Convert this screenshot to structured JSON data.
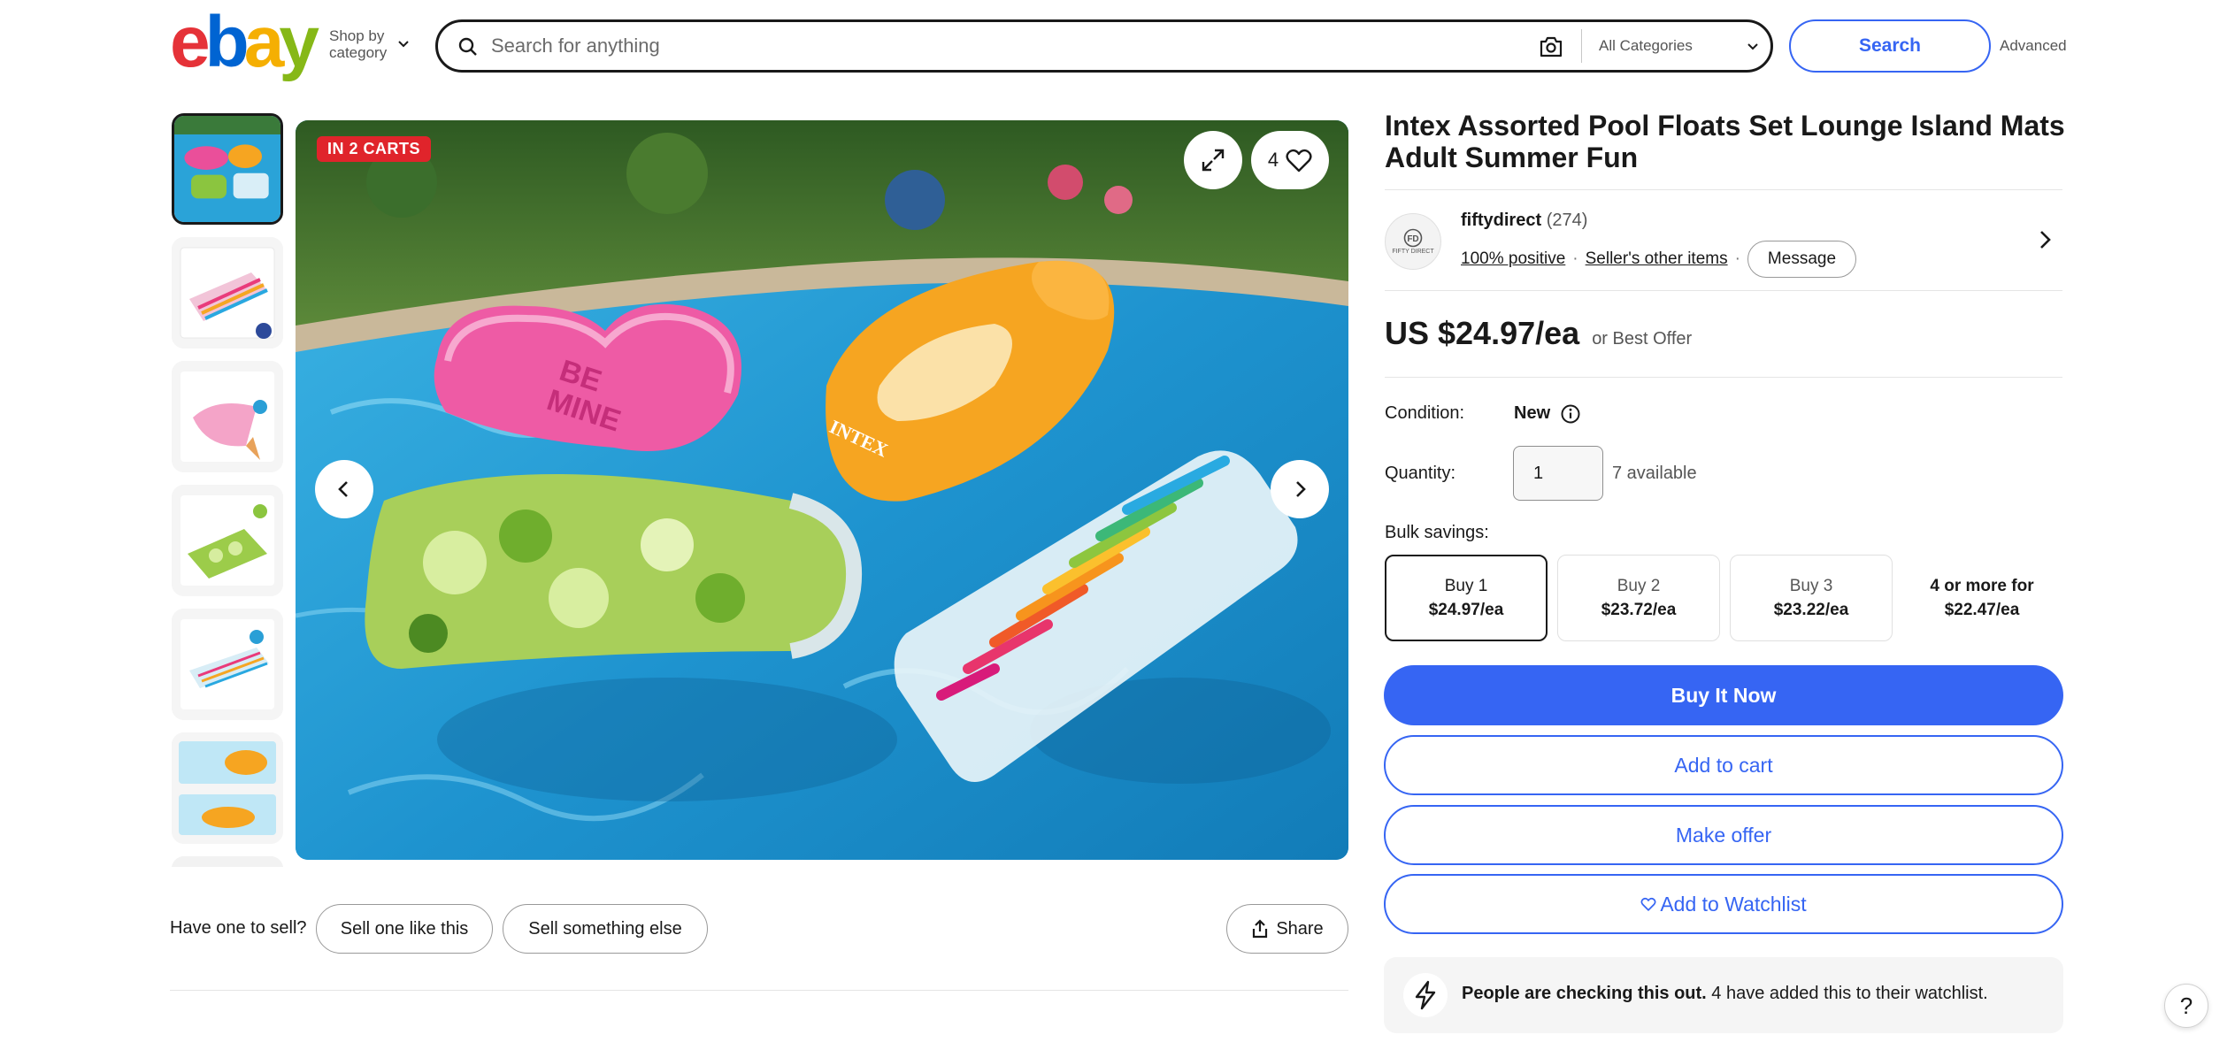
{
  "header": {
    "logo": [
      "e",
      "b",
      "a",
      "y"
    ],
    "shop_by_category": "Shop by category",
    "search_placeholder": "Search for anything",
    "category_selected": "All Categories",
    "search_button": "Search",
    "advanced_link": "Advanced"
  },
  "gallery": {
    "badge": "IN 2 CARTS",
    "watch_count": "4",
    "thumbnail_count": 7
  },
  "sell": {
    "question": "Have one to sell?",
    "sell_like_this": "Sell one like this",
    "sell_else": "Sell something else",
    "share": "Share"
  },
  "product": {
    "title": "Intex Assorted Pool Floats Set Lounge Island Mats Adult Summer Fun",
    "price": "US $24.97/ea",
    "price_sub": "or Best Offer",
    "condition_label": "Condition:",
    "condition_value": "New",
    "quantity_label": "Quantity:",
    "quantity_value": "1",
    "quantity_available": "7 available",
    "bulk_label": "Bulk savings:"
  },
  "seller": {
    "name": "fiftydirect",
    "feedback_count": "(274)",
    "positive": "100% positive",
    "other_items": "Seller's other items",
    "message": "Message",
    "avatar_text": "FIFTY DIRECT"
  },
  "bulk_options": [
    {
      "qty": "Buy 1",
      "price": "$24.97/ea"
    },
    {
      "qty": "Buy 2",
      "price": "$23.72/ea"
    },
    {
      "qty": "Buy 3",
      "price": "$23.22/ea"
    },
    {
      "qty": "4 or more for",
      "price": "$22.47/ea"
    }
  ],
  "actions": {
    "buy_now": "Buy It Now",
    "add_to_cart": "Add to cart",
    "make_offer": "Make offer",
    "add_to_watchlist": "Add to Watchlist"
  },
  "banner": {
    "strong": "People are checking this out.",
    "rest": " 4 have added this to their watchlist."
  },
  "help": "?",
  "colors": {
    "ebay_red": "#e53238",
    "ebay_blue": "#0064d2",
    "ebay_yellow": "#f5af02",
    "ebay_green": "#86b817",
    "primary": "#3665f3",
    "badge_red": "#e0242b"
  }
}
